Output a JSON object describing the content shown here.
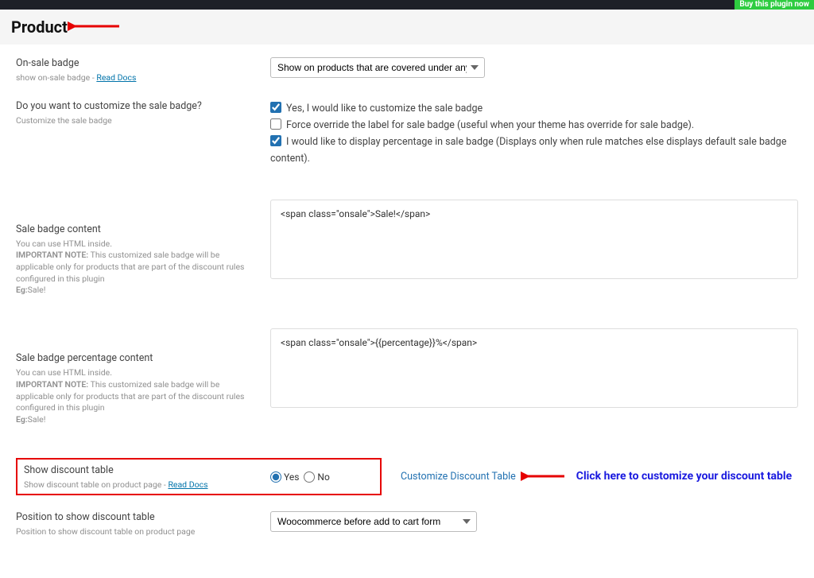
{
  "topbar": {
    "buy_label": "Buy this plugin now"
  },
  "header": {
    "title": "Product"
  },
  "onsale_badge": {
    "label": "On-sale badge",
    "help_prefix": "show on-sale badge - ",
    "docs_link": "Read Docs",
    "select_value": "Show on products that are covered under any discount ru"
  },
  "customize_badge": {
    "label": "Do you want to customize the sale badge?",
    "help": "Customize the sale badge",
    "options": {
      "opt1": {
        "checked": true,
        "label": "Yes, I would like to customize the sale badge"
      },
      "opt2": {
        "checked": false,
        "label": "Force override the label for sale badge (useful when your theme has override for sale badge)."
      },
      "opt3": {
        "checked": true,
        "label": "I would like to display percentage in sale badge (Displays only when rule matches else displays default sale badge content)."
      }
    }
  },
  "sale_badge_content": {
    "label": "Sale badge content",
    "help_line1": "You can use HTML inside.",
    "help_note_label": "IMPORTANT NOTE:",
    "help_note_text": " This customized sale badge will be applicable only for products that are part of the discount rules configured in this plugin ",
    "help_eg_label": "Eg:",
    "help_eg_text": "Sale!",
    "textarea_value": "<span class=\"onsale\">Sale!</span>"
  },
  "sale_badge_pct": {
    "label": "Sale badge percentage content",
    "help_line1": "You can use HTML inside.",
    "help_note_label": "IMPORTANT NOTE:",
    "help_note_text": " This customized sale badge will be applicable only for products that are part of the discount rules configured in this plugin ",
    "help_eg_label": "Eg:",
    "help_eg_text": "Sale!",
    "textarea_value": "<span class=\"onsale\">{{percentage}}%</span>"
  },
  "discount_table": {
    "label": "Show discount table",
    "help_prefix": "Show discount table on product page - ",
    "docs_link": "Read Docs",
    "radio_yes": "Yes",
    "radio_no": "No",
    "customize_link": "Customize Discount Table",
    "blue_note": "Click here to customize your discount table"
  },
  "position": {
    "label": "Position to show discount table",
    "help": "Position to show discount table on product page",
    "select_value": "Woocommerce before add to cart form"
  },
  "colors": {
    "annotation_red": "#e60000",
    "annotation_blue": "#1a1adf"
  }
}
